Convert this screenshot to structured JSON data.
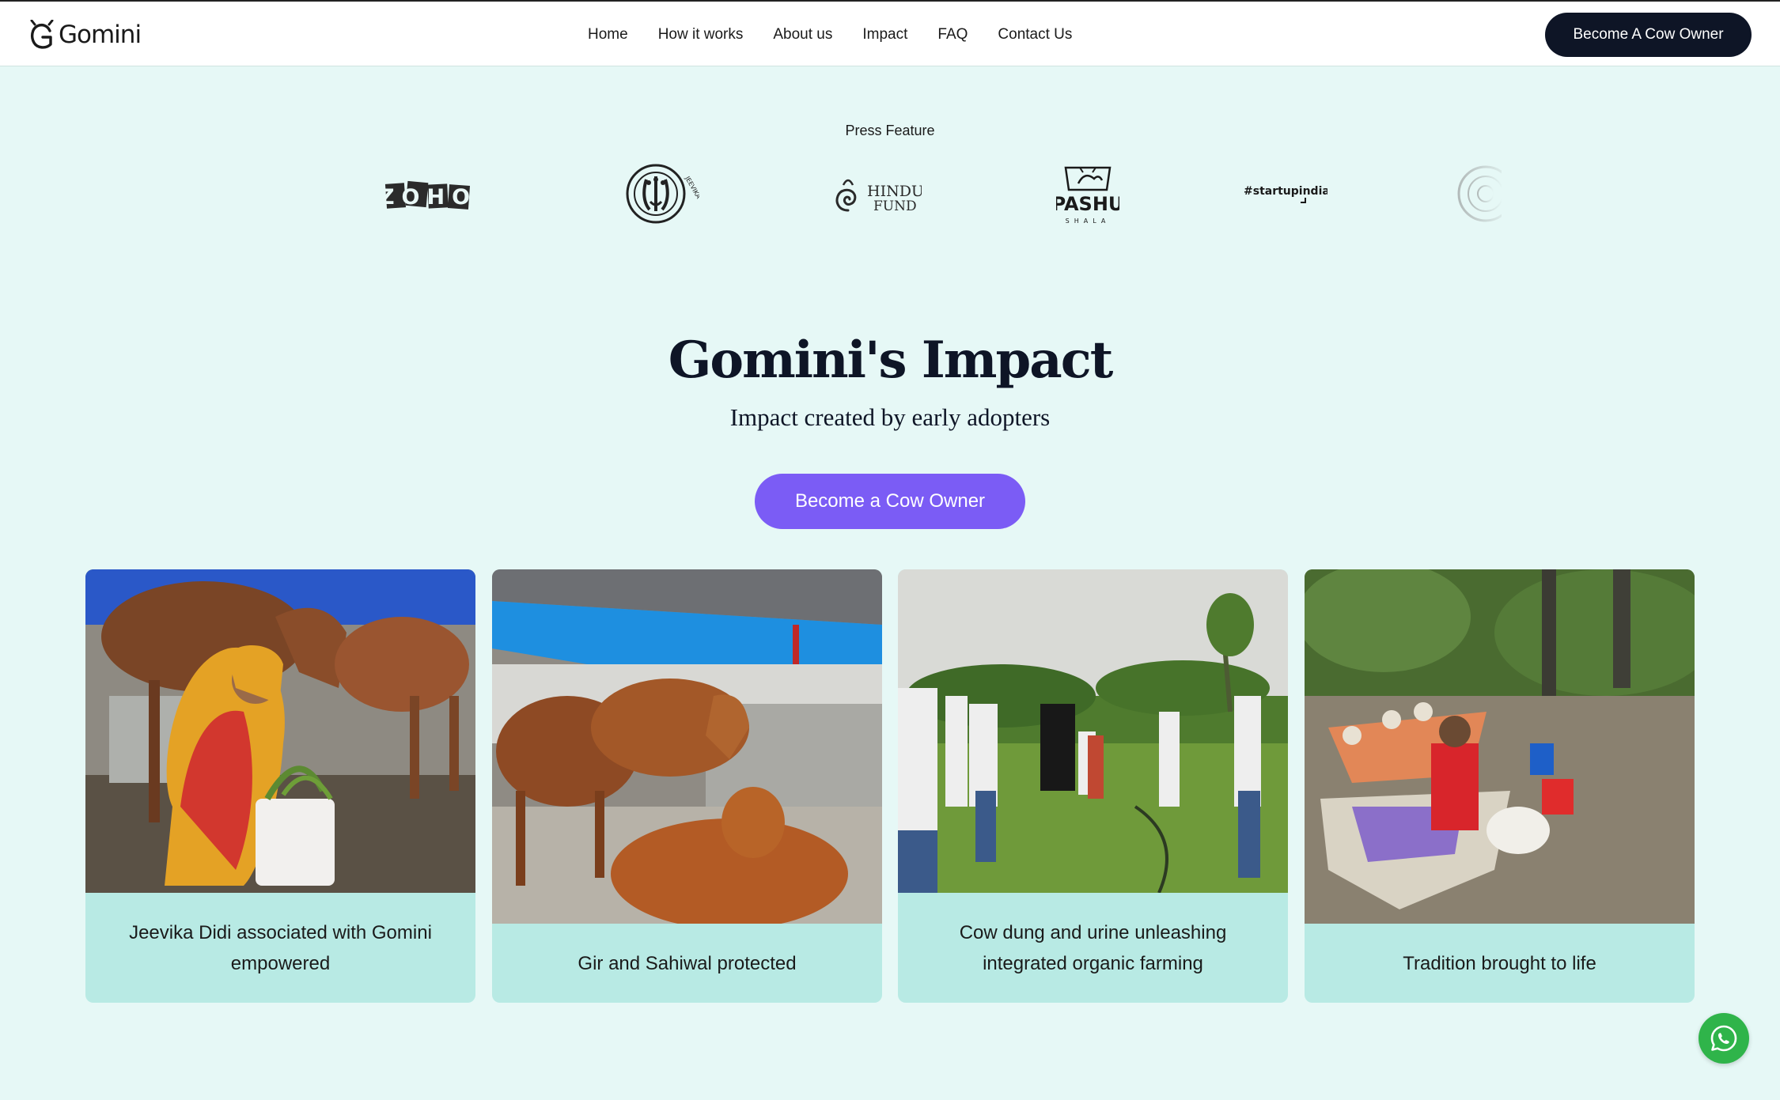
{
  "header": {
    "logo_text": "Gomini",
    "nav": [
      "Home",
      "How it works",
      "About us",
      "Impact",
      "FAQ",
      "Contact Us"
    ],
    "cta_label": "Become A Cow Owner"
  },
  "press": {
    "title": "Press Feature",
    "logos": [
      {
        "name": "zoho",
        "text": "ZOHO"
      },
      {
        "name": "jeevika",
        "text": "JEEVIKA"
      },
      {
        "name": "hindu-fund",
        "text_line1": "HINDU",
        "text_line2": "FUND"
      },
      {
        "name": "pashushala",
        "text_line1": "PASHU",
        "text_line2": "SHALA"
      },
      {
        "name": "startupindia",
        "text": "#startupindia"
      }
    ]
  },
  "impact": {
    "title": "Gomini's Impact",
    "subtitle": "Impact created by early adopters",
    "cta_label": "Become a Cow Owner"
  },
  "cards": [
    {
      "caption": "Jeevika Didi associated with Gomini empowered"
    },
    {
      "caption": "Gir and Sahiwal protected"
    },
    {
      "caption": "Cow dung and urine unleashing integrated organic farming"
    },
    {
      "caption": "Tradition brought to life"
    }
  ],
  "colors": {
    "page_bg": "#e6f8f6",
    "header_bg": "#ffffff",
    "header_cta_bg": "#0e1526",
    "impact_cta_bg": "#7b5cf5",
    "card_caption_bg": "#b8eae4",
    "whatsapp_bg": "#2fb44a"
  },
  "icons": {
    "whatsapp": "whatsapp-icon",
    "logo": "cow-head-logo-icon"
  }
}
